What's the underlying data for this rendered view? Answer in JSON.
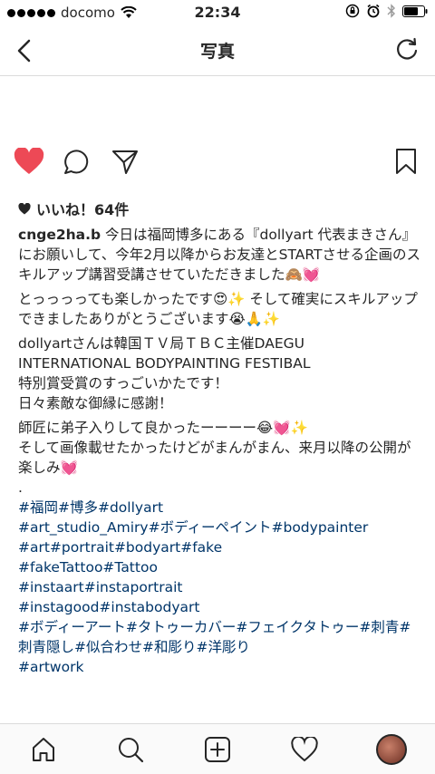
{
  "status_bar": {
    "carrier": "docomo",
    "time": "22:34"
  },
  "nav": {
    "title": "写真"
  },
  "likes": {
    "label": "いいね！64件"
  },
  "post": {
    "username": "cnge2ha.b",
    "lines": [
      "今日は福岡博多にある『dollyart 代表まきさん』にお願いして、",
      "今年2月以降からお友達とSTARTさせる企画のスキルアップ講習受講させていただきました🙈💓",
      "とっっっっても楽しかったです😍✨ そして確実にスキルアップできましたありがとうございます😭🙏✨",
      "dollyartさんは韓国ＴＶ局ＴＢＣ主催DAEGU INTERNATIONAL BODYPAINTING FESTIBAL",
      "特別賞受賞のすっごいかたです！",
      "日々素敵な御縁に感謝！",
      "師匠に弟子入りして良かったーーーー😂💓✨",
      "そして画像載せたかったけどがまんがまん、来月以降の公開が楽しみ💓",
      "."
    ],
    "hashtags": [
      "#福岡#博多#dollyart",
      "#art_studio_Amiry#ボディーペイント#bodypainter",
      "#art#portrait#bodyart#fake",
      "#fakeTattoo#Tattoo",
      "#instaart#instaportrait",
      "#instagood#instabodyart",
      "#ボディーアート#タトゥーカバー#フェイクタトゥー#刺青#刺青隠し#似合わせ#和彫り#洋彫り",
      "#artwork"
    ]
  },
  "colors": {
    "like_red": "#ed4956",
    "hashtag_blue": "#003569"
  }
}
